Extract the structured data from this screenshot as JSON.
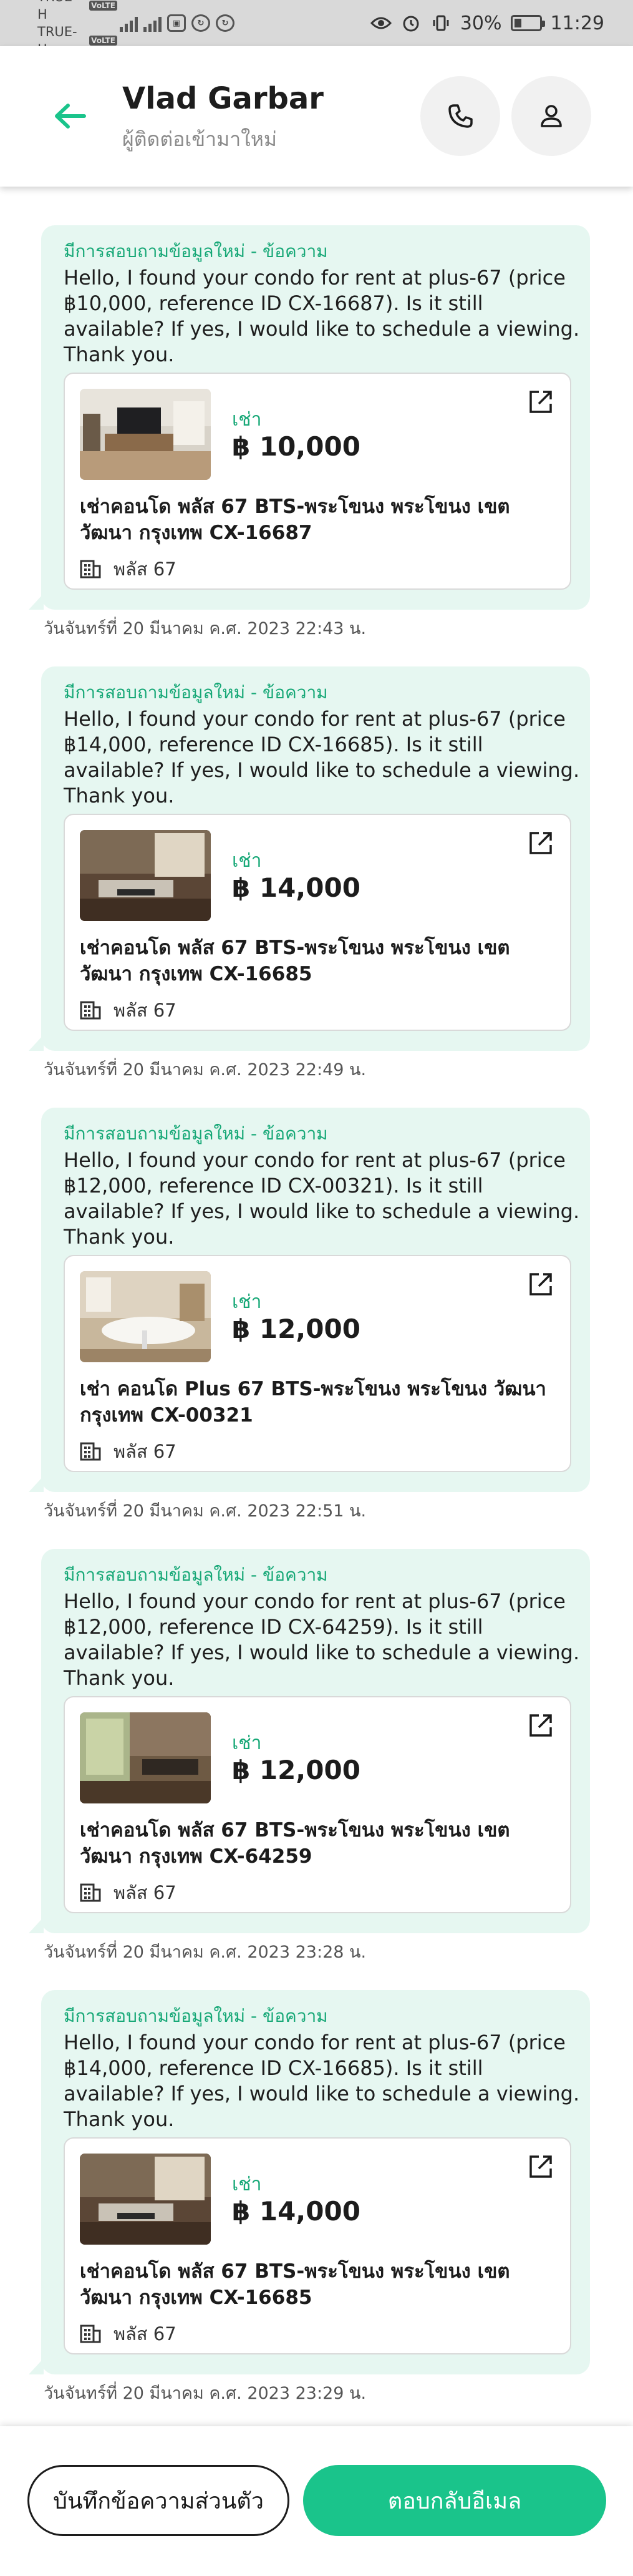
{
  "status_bar": {
    "carriers": [
      {
        "name": "TRUE-H",
        "tag": "VoLTE"
      },
      {
        "name": "TRUE-H",
        "tag": "VoLTE"
      }
    ],
    "battery_text": "30%",
    "battery_level": 0.3,
    "time": "11:29"
  },
  "header": {
    "contact_name": "Vlad Garbar",
    "contact_subtitle": "ผู้ติดต่อเข้ามาใหม่",
    "back_icon": "arrow-left-icon",
    "call_icon": "phone-icon",
    "profile_icon": "person-icon"
  },
  "accent_color": "#1ac48b",
  "bubble_color": "#e6f7f1",
  "messages": [
    {
      "inquiry_title": "มีการสอบถามข้อมูลใหม่ - ข้อความ",
      "body": "Hello, I found your condo for rent at plus-67 (price ฿10,000, reference ID CX-16687). Is it still available? If yes, I would like to schedule a viewing. Thank you.",
      "listing": {
        "type_label": "เช่า",
        "price": "฿ 10,000",
        "title": "เช่าคอนโด  พลัส 67 BTS-พระโขนง พระโขนง เขต วัฒนา กรุงเทพ CX-16687",
        "project": "พลัส 67"
      },
      "time": "วันจันทร์ที่ 20 มีนาคม ค.ศ. 2023 22:43 น."
    },
    {
      "inquiry_title": "มีการสอบถามข้อมูลใหม่ - ข้อความ",
      "body": "Hello, I found your condo for rent at plus-67 (price ฿14,000, reference ID CX-16685). Is it still available? If yes, I would like to schedule a viewing. Thank you.",
      "listing": {
        "type_label": "เช่า",
        "price": "฿ 14,000",
        "title": "เช่าคอนโด  พลัส 67 BTS-พระโขนง พระโขนง เขต วัฒนา กรุงเทพ CX-16685",
        "project": "พลัส 67"
      },
      "time": "วันจันทร์ที่ 20 มีนาคม ค.ศ. 2023 22:49 น."
    },
    {
      "inquiry_title": "มีการสอบถามข้อมูลใหม่ - ข้อความ",
      "body": "Hello, I found your condo for rent at plus-67 (price ฿12,000, reference ID CX-00321). Is it still available? If yes, I would like to schedule a viewing. Thank you.",
      "listing": {
        "type_label": "เช่า",
        "price": "฿ 12,000",
        "title": "เช่า คอนโด  Plus 67 BTS-พระโขนง  พระโขนง วัฒนา กรุงเทพ CX-00321",
        "project": "พลัส 67"
      },
      "time": "วันจันทร์ที่ 20 มีนาคม ค.ศ. 2023 22:51 น."
    },
    {
      "inquiry_title": "มีการสอบถามข้อมูลใหม่ - ข้อความ",
      "body": "Hello, I found your condo for rent at plus-67 (price ฿12,000, reference ID CX-64259). Is it still available? If yes, I would like to schedule a viewing. Thank you.",
      "listing": {
        "type_label": "เช่า",
        "price": "฿ 12,000",
        "title": "เช่าคอนโด  พลัส 67 BTS-พระโขนง พระโขนง เขต วัฒนา กรุงเทพ CX-64259",
        "project": "พลัส 67"
      },
      "time": "วันจันทร์ที่ 20 มีนาคม ค.ศ. 2023 23:28 น."
    },
    {
      "inquiry_title": "มีการสอบถามข้อมูลใหม่ - ข้อความ",
      "body": "Hello, I found your condo for rent at plus-67 (price ฿14,000, reference ID CX-16685). Is it still available? If yes, I would like to schedule a viewing. Thank you.",
      "listing": {
        "type_label": "เช่า",
        "price": "฿ 14,000",
        "title": "เช่าคอนโด  พลัส 67 BTS-พระโขนง พระโขนง เขต วัฒนา กรุงเทพ CX-16685",
        "project": "พลัส 67"
      },
      "time": "วันจันทร์ที่ 20 มีนาคม ค.ศ. 2023 23:29 น."
    }
  ],
  "bottom_bar": {
    "note_button": "บันทึกข้อความส่วนตัว",
    "reply_button": "ตอบกลับอีเมล"
  }
}
